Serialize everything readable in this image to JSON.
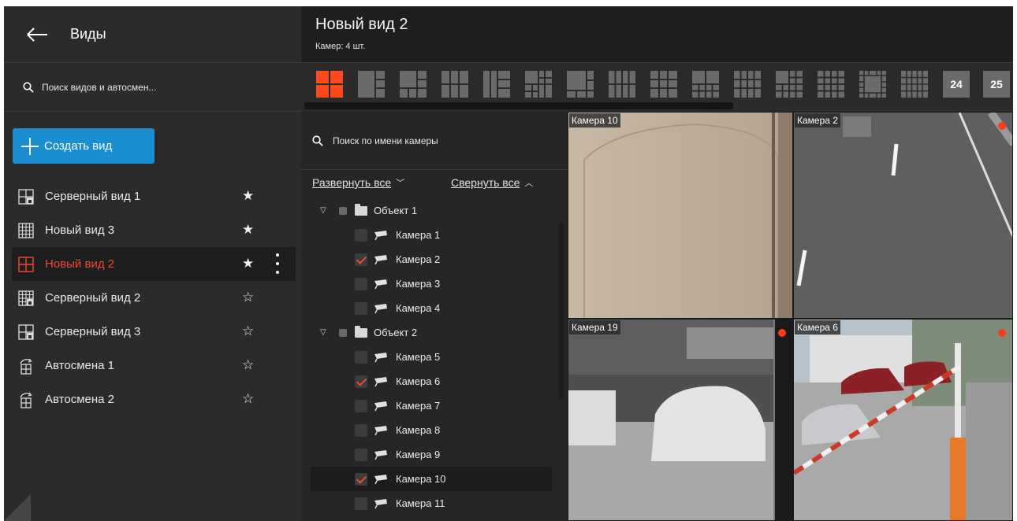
{
  "left": {
    "title": "Виды",
    "search_placeholder": "Поиск видов и автосмен...",
    "create_label": "Создать вид",
    "views": [
      {
        "name": "Серверный вид 1",
        "icon": "server-layout-icon",
        "favorite": true,
        "active": false
      },
      {
        "name": "Новый вид 3",
        "icon": "grid-layout-icon",
        "favorite": true,
        "active": false
      },
      {
        "name": "Новый вид 2",
        "icon": "quad-layout-icon",
        "favorite": true,
        "active": true
      },
      {
        "name": "Серверный вид 2",
        "icon": "server-grid-layout-icon",
        "favorite": false,
        "active": false
      },
      {
        "name": "Серверный вид 3",
        "icon": "server-layout-icon",
        "favorite": false,
        "active": false
      },
      {
        "name": "Автосмена 1",
        "icon": "auto-switch-icon",
        "favorite": false,
        "active": false
      },
      {
        "name": "Автосмена 2",
        "icon": "auto-switch-icon",
        "favorite": false,
        "active": false
      }
    ]
  },
  "header": {
    "view_title": "Новый вид 2",
    "camera_count": "Камер: 4 шт."
  },
  "layouts": {
    "numbered": [
      "24",
      "25"
    ],
    "active_color": "#ff4a1c",
    "idle_color": "#6b6b6b"
  },
  "tree": {
    "search_placeholder": "Поиск по имени камеры",
    "expand_all": "Развернуть все",
    "collapse_all": "Свернуть все",
    "rows": [
      {
        "type": "object",
        "label": "Объект 1"
      },
      {
        "type": "camera",
        "label": "Камера 1",
        "checked": false
      },
      {
        "type": "camera",
        "label": "Камера 2",
        "checked": true
      },
      {
        "type": "camera",
        "label": "Камера 3",
        "checked": false
      },
      {
        "type": "camera",
        "label": "Камера 4",
        "checked": false
      },
      {
        "type": "object",
        "label": "Объект 2"
      },
      {
        "type": "camera",
        "label": "Камера 5",
        "checked": false
      },
      {
        "type": "camera",
        "label": "Камера 6",
        "checked": true
      },
      {
        "type": "camera",
        "label": "Камера 7",
        "checked": false
      },
      {
        "type": "camera",
        "label": "Камера 8",
        "checked": false
      },
      {
        "type": "camera",
        "label": "Камера 9",
        "checked": false
      },
      {
        "type": "camera",
        "label": "Камера 10",
        "checked": true,
        "selected": true
      },
      {
        "type": "camera",
        "label": "Камера 11",
        "checked": false
      }
    ]
  },
  "cameras": [
    {
      "label": "Камера 10",
      "recording": false
    },
    {
      "label": "Камера 2",
      "recording": true
    },
    {
      "label": "Камера 19",
      "recording": true
    },
    {
      "label": "Камера 6",
      "recording": true
    }
  ],
  "colors": {
    "accent_red": "#ee4a33",
    "create_blue": "#1a8ed0",
    "record_dot": "#ff3b1f"
  }
}
